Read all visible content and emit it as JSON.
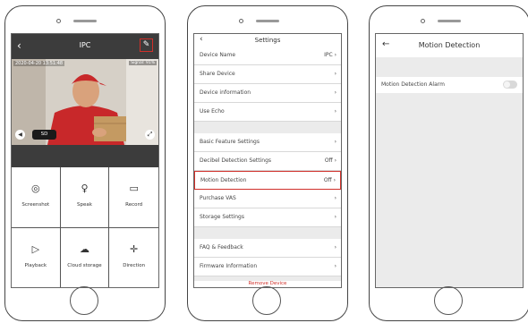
{
  "phone1": {
    "header": {
      "back_icon": "‹",
      "title": "IPC",
      "edit_icon": "✎"
    },
    "video": {
      "timestamp": "2020-04-20 13:51:48",
      "signal": "Signal: 91%",
      "quality": "SD"
    },
    "actions": [
      {
        "label": "Screenshot",
        "icon": "camera-icon",
        "glyph": "◎"
      },
      {
        "label": "Speak",
        "icon": "microphone-icon",
        "glyph": "♀"
      },
      {
        "label": "Record",
        "icon": "video-camera-icon",
        "glyph": "▭"
      },
      {
        "label": "Playback",
        "icon": "play-icon",
        "glyph": "▷"
      },
      {
        "label": "Cloud storage",
        "icon": "cloud-icon",
        "glyph": "☁"
      },
      {
        "label": "Direction",
        "icon": "direction-icon",
        "glyph": "✛"
      }
    ]
  },
  "phone2": {
    "header": {
      "back_icon": "‹",
      "title": "Settings"
    },
    "group1": [
      {
        "label": "Device Name",
        "value": "IPC ›"
      },
      {
        "label": "Share Device",
        "value": "›"
      },
      {
        "label": "Device information",
        "value": "›"
      },
      {
        "label": "Use Echo",
        "value": "›"
      }
    ],
    "group2": [
      {
        "label": "Basic Feature Settings",
        "value": "›"
      },
      {
        "label": "Decibel Detection Settings",
        "value": "Off ›"
      },
      {
        "label": "Motion Detection",
        "value": "Off ›"
      },
      {
        "label": "Purchase VAS",
        "value": "›"
      },
      {
        "label": "Storage Settings",
        "value": "›"
      }
    ],
    "group3": [
      {
        "label": "FAQ & Feedback",
        "value": "›"
      },
      {
        "label": "Firmware Information",
        "value": "›"
      }
    ],
    "remove_label": "Remove Device"
  },
  "phone3": {
    "header": {
      "back_icon": "←",
      "title": "Motion Detection"
    },
    "alarm_label": "Motion Detection Alarm",
    "alarm_on": false
  },
  "colors": {
    "highlight": "#d0302a",
    "dark_bar": "#3c3c3c",
    "section_gap": "#ebebeb"
  }
}
